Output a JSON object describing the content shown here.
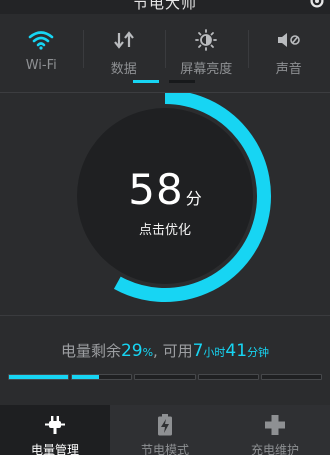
{
  "app": {
    "title": "节电大师"
  },
  "toggles": [
    {
      "label": "Wi-Fi",
      "icon": "wifi-icon",
      "active": true
    },
    {
      "label": "数据",
      "icon": "data-arrows-icon",
      "active": false
    },
    {
      "label": "屏幕亮度",
      "icon": "brightness-icon",
      "active": false
    },
    {
      "label": "声音",
      "icon": "sound-muted-icon",
      "active": false
    }
  ],
  "gauge": {
    "score": "58",
    "unit": "分",
    "action_label": "点击优化",
    "fill_fraction": 0.58
  },
  "battery": {
    "prefix": "电量剩余",
    "percent": "29",
    "percent_sign": "%",
    "mid": ", 可用",
    "hours": "7",
    "hours_unit": "小时",
    "minutes": "41",
    "minutes_unit": "分钟",
    "level_fraction": 0.29,
    "segments": 5
  },
  "bottom_nav": [
    {
      "label": "电量管理",
      "icon": "plug-icon",
      "active": true
    },
    {
      "label": "节电模式",
      "icon": "battery-bolt-icon",
      "active": false
    },
    {
      "label": "充电维护",
      "icon": "plus-icon",
      "active": false
    }
  ],
  "colors": {
    "accent": "#17d5f3",
    "background": "#2b2c2e",
    "active_tab": "#1e1f21"
  }
}
